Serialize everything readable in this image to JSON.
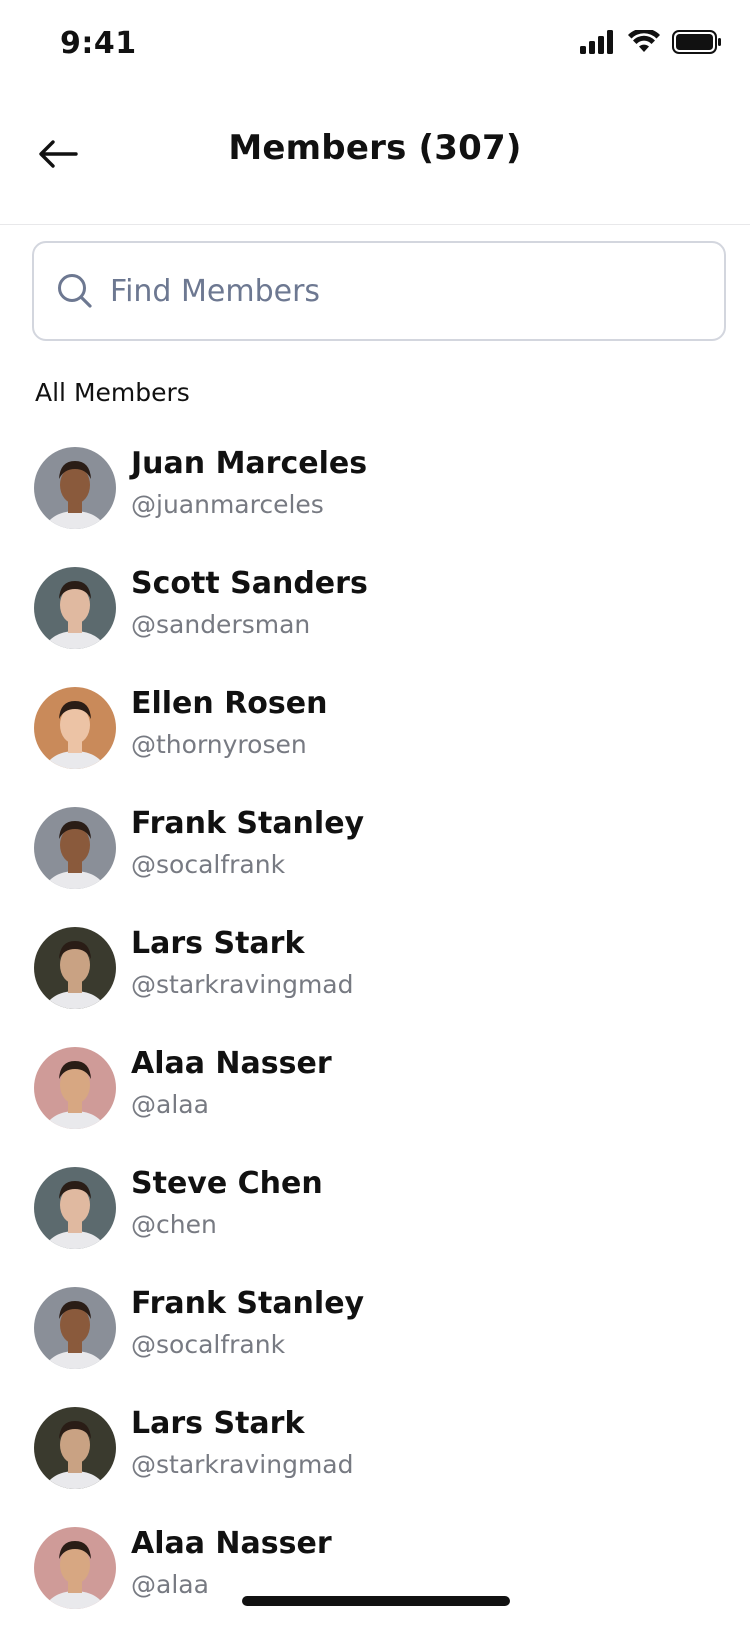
{
  "status_bar": {
    "time": "9:41"
  },
  "header": {
    "title": "Members (307)"
  },
  "search": {
    "placeholder": "Find Members",
    "value": ""
  },
  "section": {
    "label": "All Members"
  },
  "members": [
    {
      "name": "Juan Marceles",
      "handle": "@juanmarceles",
      "avatar_bg": "#8a8f98",
      "skin": "#8a5a3c"
    },
    {
      "name": "Scott Sanders",
      "handle": "@sandersman",
      "avatar_bg": "#5c6a6e",
      "skin": "#e0b9a0"
    },
    {
      "name": "Ellen Rosen",
      "handle": "@thornyrosen",
      "avatar_bg": "#c98a5a",
      "skin": "#ecc3a5"
    },
    {
      "name": "Frank Stanley",
      "handle": "@socalfrank",
      "avatar_bg": "#8a8f98",
      "skin": "#8a5a3c"
    },
    {
      "name": "Lars Stark",
      "handle": "@starkravingmad",
      "avatar_bg": "#3a3a2e",
      "skin": "#c9a283"
    },
    {
      "name": "Alaa Nasser",
      "handle": "@alaa",
      "avatar_bg": "#cf9b98",
      "skin": "#d7a782"
    },
    {
      "name": "Steve Chen",
      "handle": "@chen",
      "avatar_bg": "#5c6a6e",
      "skin": "#e0b9a0"
    },
    {
      "name": "Frank Stanley",
      "handle": "@socalfrank",
      "avatar_bg": "#8a8f98",
      "skin": "#8a5a3c"
    },
    {
      "name": "Lars Stark",
      "handle": "@starkravingmad",
      "avatar_bg": "#3a3a2e",
      "skin": "#c9a283"
    },
    {
      "name": "Alaa Nasser",
      "handle": "@alaa",
      "avatar_bg": "#cf9b98",
      "skin": "#d7a782"
    }
  ],
  "colors": {
    "placeholder": "#6d7891",
    "handle": "#777a82",
    "border": "#d3d6de"
  },
  "icons": {
    "back": "arrow-left-icon",
    "search": "search-icon",
    "signal": "cellular-signal-icon",
    "wifi": "wifi-icon",
    "battery": "battery-icon"
  }
}
